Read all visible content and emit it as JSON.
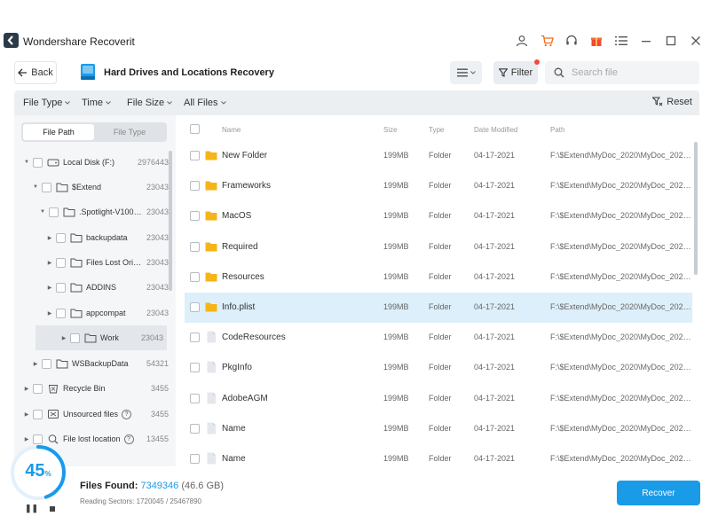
{
  "app": {
    "title": "Wondershare Recoverit"
  },
  "toolbar": {
    "back_label": "Back",
    "location_title": "Hard Drives and Locations Recovery",
    "filter_label": "Filter",
    "search_placeholder": "Search file"
  },
  "filterbar": {
    "file_type": "File Type",
    "time": "Time",
    "file_size": "File Size",
    "all_files": "All Files",
    "reset": "Reset"
  },
  "sidebar": {
    "tabs": [
      "File Path",
      "File Type"
    ],
    "tree": [
      {
        "label": "Local Disk (F:)",
        "count": "2976443"
      },
      {
        "label": "$Extend",
        "count": "23043"
      },
      {
        "label": ".Spotlight-V10000...",
        "count": "23043"
      },
      {
        "label": "backupdata",
        "count": "23043"
      },
      {
        "label": "Files Lost Origi...",
        "count": "23043"
      },
      {
        "label": "ADDINS",
        "count": "23043"
      },
      {
        "label": "appcompat",
        "count": "23043"
      },
      {
        "label": "Work",
        "count": "23043"
      },
      {
        "label": "WSBackupData",
        "count": "54321"
      },
      {
        "label": "Recycle Bin",
        "count": "3455"
      },
      {
        "label": "Unsourced files",
        "count": "3455"
      },
      {
        "label": "File lost location",
        "count": "13455"
      }
    ]
  },
  "filelist": {
    "headers": {
      "name": "Name",
      "size": "Size",
      "type": "Type",
      "date": "Date Modified",
      "path": "Path"
    },
    "rows": [
      {
        "name": "New Folder",
        "size": "199MB",
        "type": "Folder",
        "date": "04-17-2021",
        "path": "F:\\$Extend\\MyDoc_2020\\MyDoc_2020\\M...",
        "icon": "folder-icon"
      },
      {
        "name": "Frameworks",
        "size": "199MB",
        "type": "Folder",
        "date": "04-17-2021",
        "path": "F:\\$Extend\\MyDoc_2020\\MyDoc_2020\\M...",
        "icon": "folder-icon"
      },
      {
        "name": "MacOS",
        "size": "199MB",
        "type": "Folder",
        "date": "04-17-2021",
        "path": "F:\\$Extend\\MyDoc_2020\\MyDoc_2020\\M...",
        "icon": "folder-icon"
      },
      {
        "name": "Required",
        "size": "199MB",
        "type": "Folder",
        "date": "04-17-2021",
        "path": "F:\\$Extend\\MyDoc_2020\\MyDoc_2020\\M...",
        "icon": "folder-icon"
      },
      {
        "name": "Resources",
        "size": "199MB",
        "type": "Folder",
        "date": "04-17-2021",
        "path": "F:\\$Extend\\MyDoc_2020\\MyDoc_2020\\M...",
        "icon": "folder-icon"
      },
      {
        "name": "Info.plist",
        "size": "199MB",
        "type": "Folder",
        "date": "04-17-2021",
        "path": "F:\\$Extend\\MyDoc_2020\\MyDoc_2020\\M...",
        "icon": "folder-icon"
      },
      {
        "name": "CodeResources",
        "size": "199MB",
        "type": "Folder",
        "date": "04-17-2021",
        "path": "F:\\$Extend\\MyDoc_2020\\MyDoc_2020\\M...",
        "icon": "file-icon"
      },
      {
        "name": "PkgInfo",
        "size": "199MB",
        "type": "Folder",
        "date": "04-17-2021",
        "path": "F:\\$Extend\\MyDoc_2020\\MyDoc_2020\\M...",
        "icon": "file-icon"
      },
      {
        "name": "AdobeAGM",
        "size": "199MB",
        "type": "Folder",
        "date": "04-17-2021",
        "path": "F:\\$Extend\\MyDoc_2020\\MyDoc_2020\\M...",
        "icon": "file-icon"
      },
      {
        "name": "Name",
        "size": "199MB",
        "type": "Folder",
        "date": "04-17-2021",
        "path": "F:\\$Extend\\MyDoc_2020\\MyDoc_2020\\M...",
        "icon": "file-icon"
      },
      {
        "name": "Name",
        "size": "199MB",
        "type": "Folder",
        "date": "04-17-2021",
        "path": "F:\\$Extend\\MyDoc_2020\\MyDoc_2020\\M...",
        "icon": "file-icon"
      }
    ]
  },
  "status": {
    "progress_value": "45",
    "progress_unit": "%",
    "files_found_label": "Files Found:",
    "files_found_count": "7349346",
    "files_found_size": "(46.6 GB)",
    "reading_sectors": "Reading Sectors: 1720045 / 25467890",
    "recover_label": "Recover"
  },
  "colors": {
    "accent": "#1a9be8",
    "folder": "#f5b418",
    "selected_row": "#ddeffa"
  }
}
